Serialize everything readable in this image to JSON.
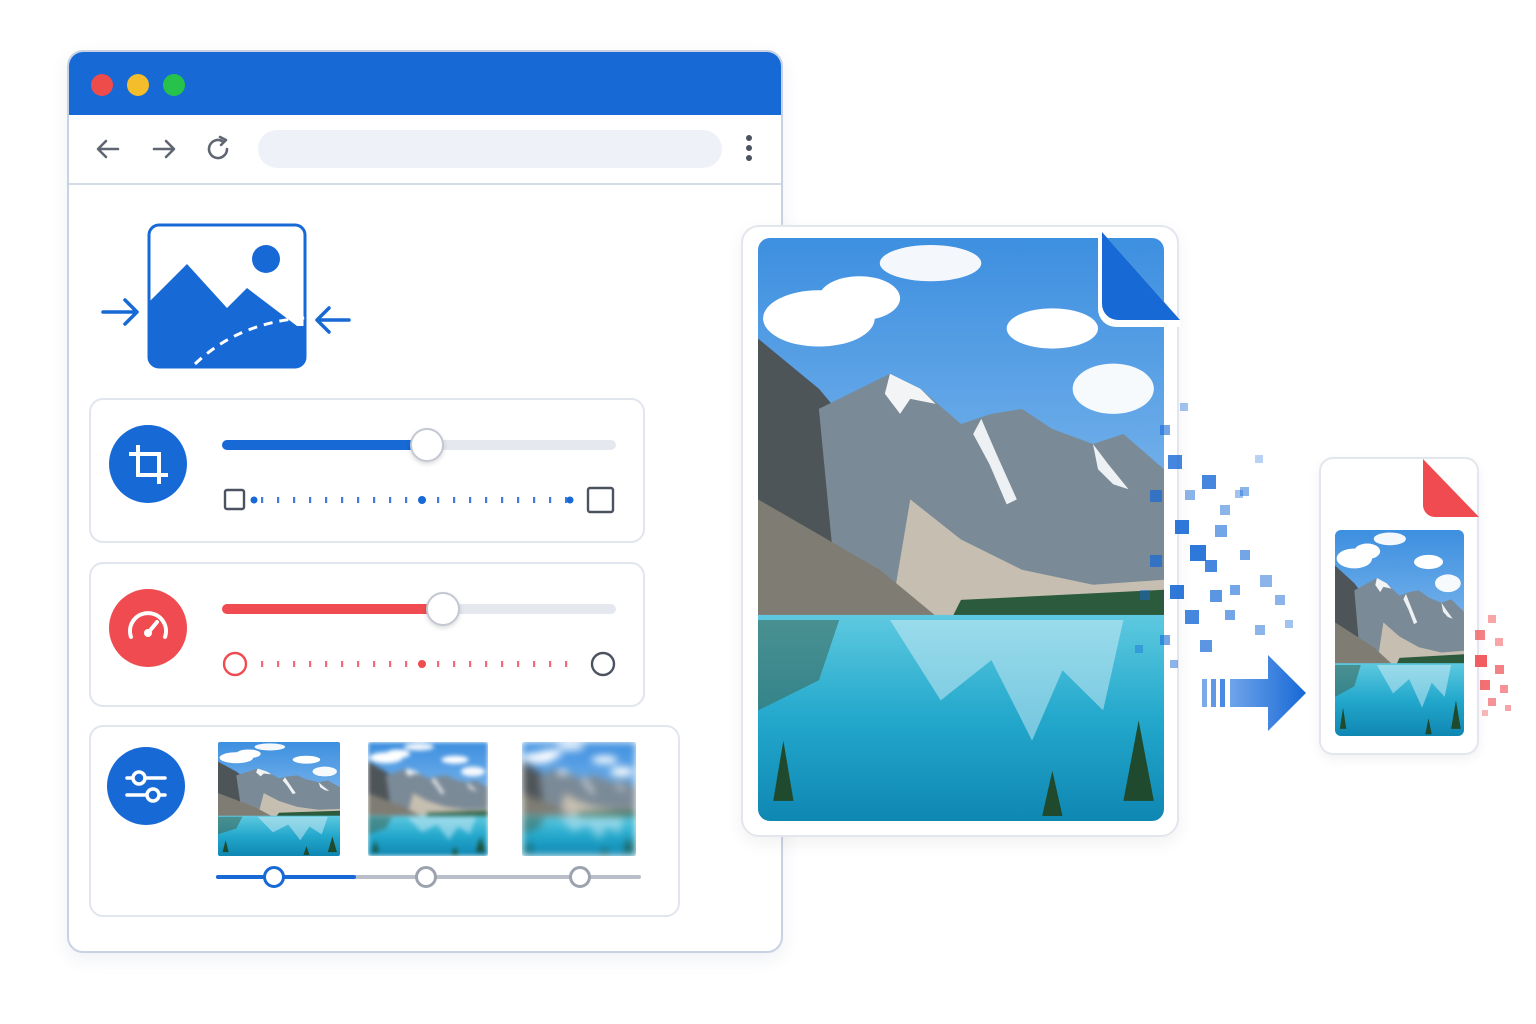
{
  "window": {
    "controls": [
      "close",
      "minimize",
      "maximize"
    ],
    "colors": {
      "titlebar": "#1769d6",
      "close": "#ee4b4b",
      "minimize": "#f4bd2b",
      "maximize": "#27c24c"
    }
  },
  "toolbar": {
    "icons": [
      "back-arrow-icon",
      "forward-arrow-icon",
      "reload-icon",
      "more-vert-icon"
    ],
    "address_value": ""
  },
  "app_icon": "image-compress-icon",
  "panels": [
    {
      "icon": "crop-icon",
      "accent": "#1769d6",
      "slider_value_fraction": 0.52,
      "scale_start_icon": "small-square-icon",
      "scale_end_icon": "large-square-icon"
    },
    {
      "icon": "speedometer-icon",
      "accent": "#ef4b50",
      "slider_value_fraction": 0.56,
      "scale_start_icon": "circle-outline-icon",
      "scale_end_icon": "circle-outline-icon"
    },
    {
      "icon": "sliders-icon",
      "accent": "#1769d6",
      "previews": [
        "sharp",
        "medium-pixelated",
        "heavy-pixelated"
      ],
      "selected_preview_index": 0
    }
  ],
  "illustration": {
    "large_file_icon": "document-icon",
    "arrow_icon": "right-arrow-icon",
    "small_file_icon": "document-icon",
    "colors": {
      "large_fold": "#1769d6",
      "small_fold": "#ef4b50"
    }
  }
}
